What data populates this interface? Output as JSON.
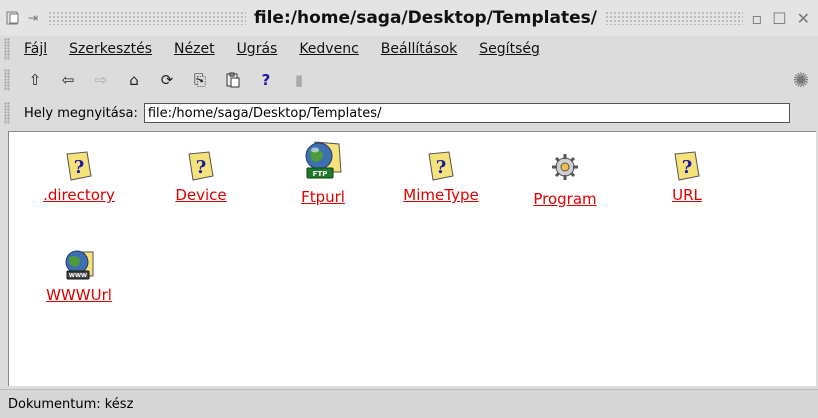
{
  "window": {
    "title": "file:/home/saga/Desktop/Templates/"
  },
  "menu": [
    {
      "label": "Fájl",
      "name": "menu-fajl"
    },
    {
      "label": "Szerkesztés",
      "name": "menu-szerkesztes"
    },
    {
      "label": "Nézet",
      "name": "menu-nezet"
    },
    {
      "label": "Ugrás",
      "name": "menu-ugras"
    },
    {
      "label": "Kedvenc",
      "name": "menu-kedvenc"
    },
    {
      "label": "Beállítások",
      "name": "menu-beallitasok"
    },
    {
      "label": "Segítség",
      "name": "menu-segitseg"
    }
  ],
  "toolbar": {
    "up_icon": "⇧",
    "back_icon": "⇦",
    "forward_icon": "⇨",
    "home_icon": "⌂",
    "reload_icon": "⟳",
    "copy_icon": "⎘",
    "paste_icon": "📋",
    "help_icon": "?",
    "stop_icon": "▮",
    "activity_icon": "✺"
  },
  "location": {
    "label": "Hely megnyitása:",
    "value": "file:/home/saga/Desktop/Templates/"
  },
  "files": [
    {
      "name": ".directory",
      "icon": "unknown-file-icon"
    },
    {
      "name": "Device",
      "icon": "unknown-file-icon"
    },
    {
      "name": "Ftpurl",
      "icon": "ftp-globe-icon"
    },
    {
      "name": "MimeType",
      "icon": "unknown-file-icon"
    },
    {
      "name": "Program",
      "icon": "gear-icon"
    },
    {
      "name": "URL",
      "icon": "unknown-file-icon"
    },
    {
      "name": "WWWUrl",
      "icon": "www-globe-icon"
    }
  ],
  "status": {
    "text": "Dokumentum: kész"
  },
  "colors": {
    "link": "#e00000",
    "help": "#1a1aa8"
  }
}
